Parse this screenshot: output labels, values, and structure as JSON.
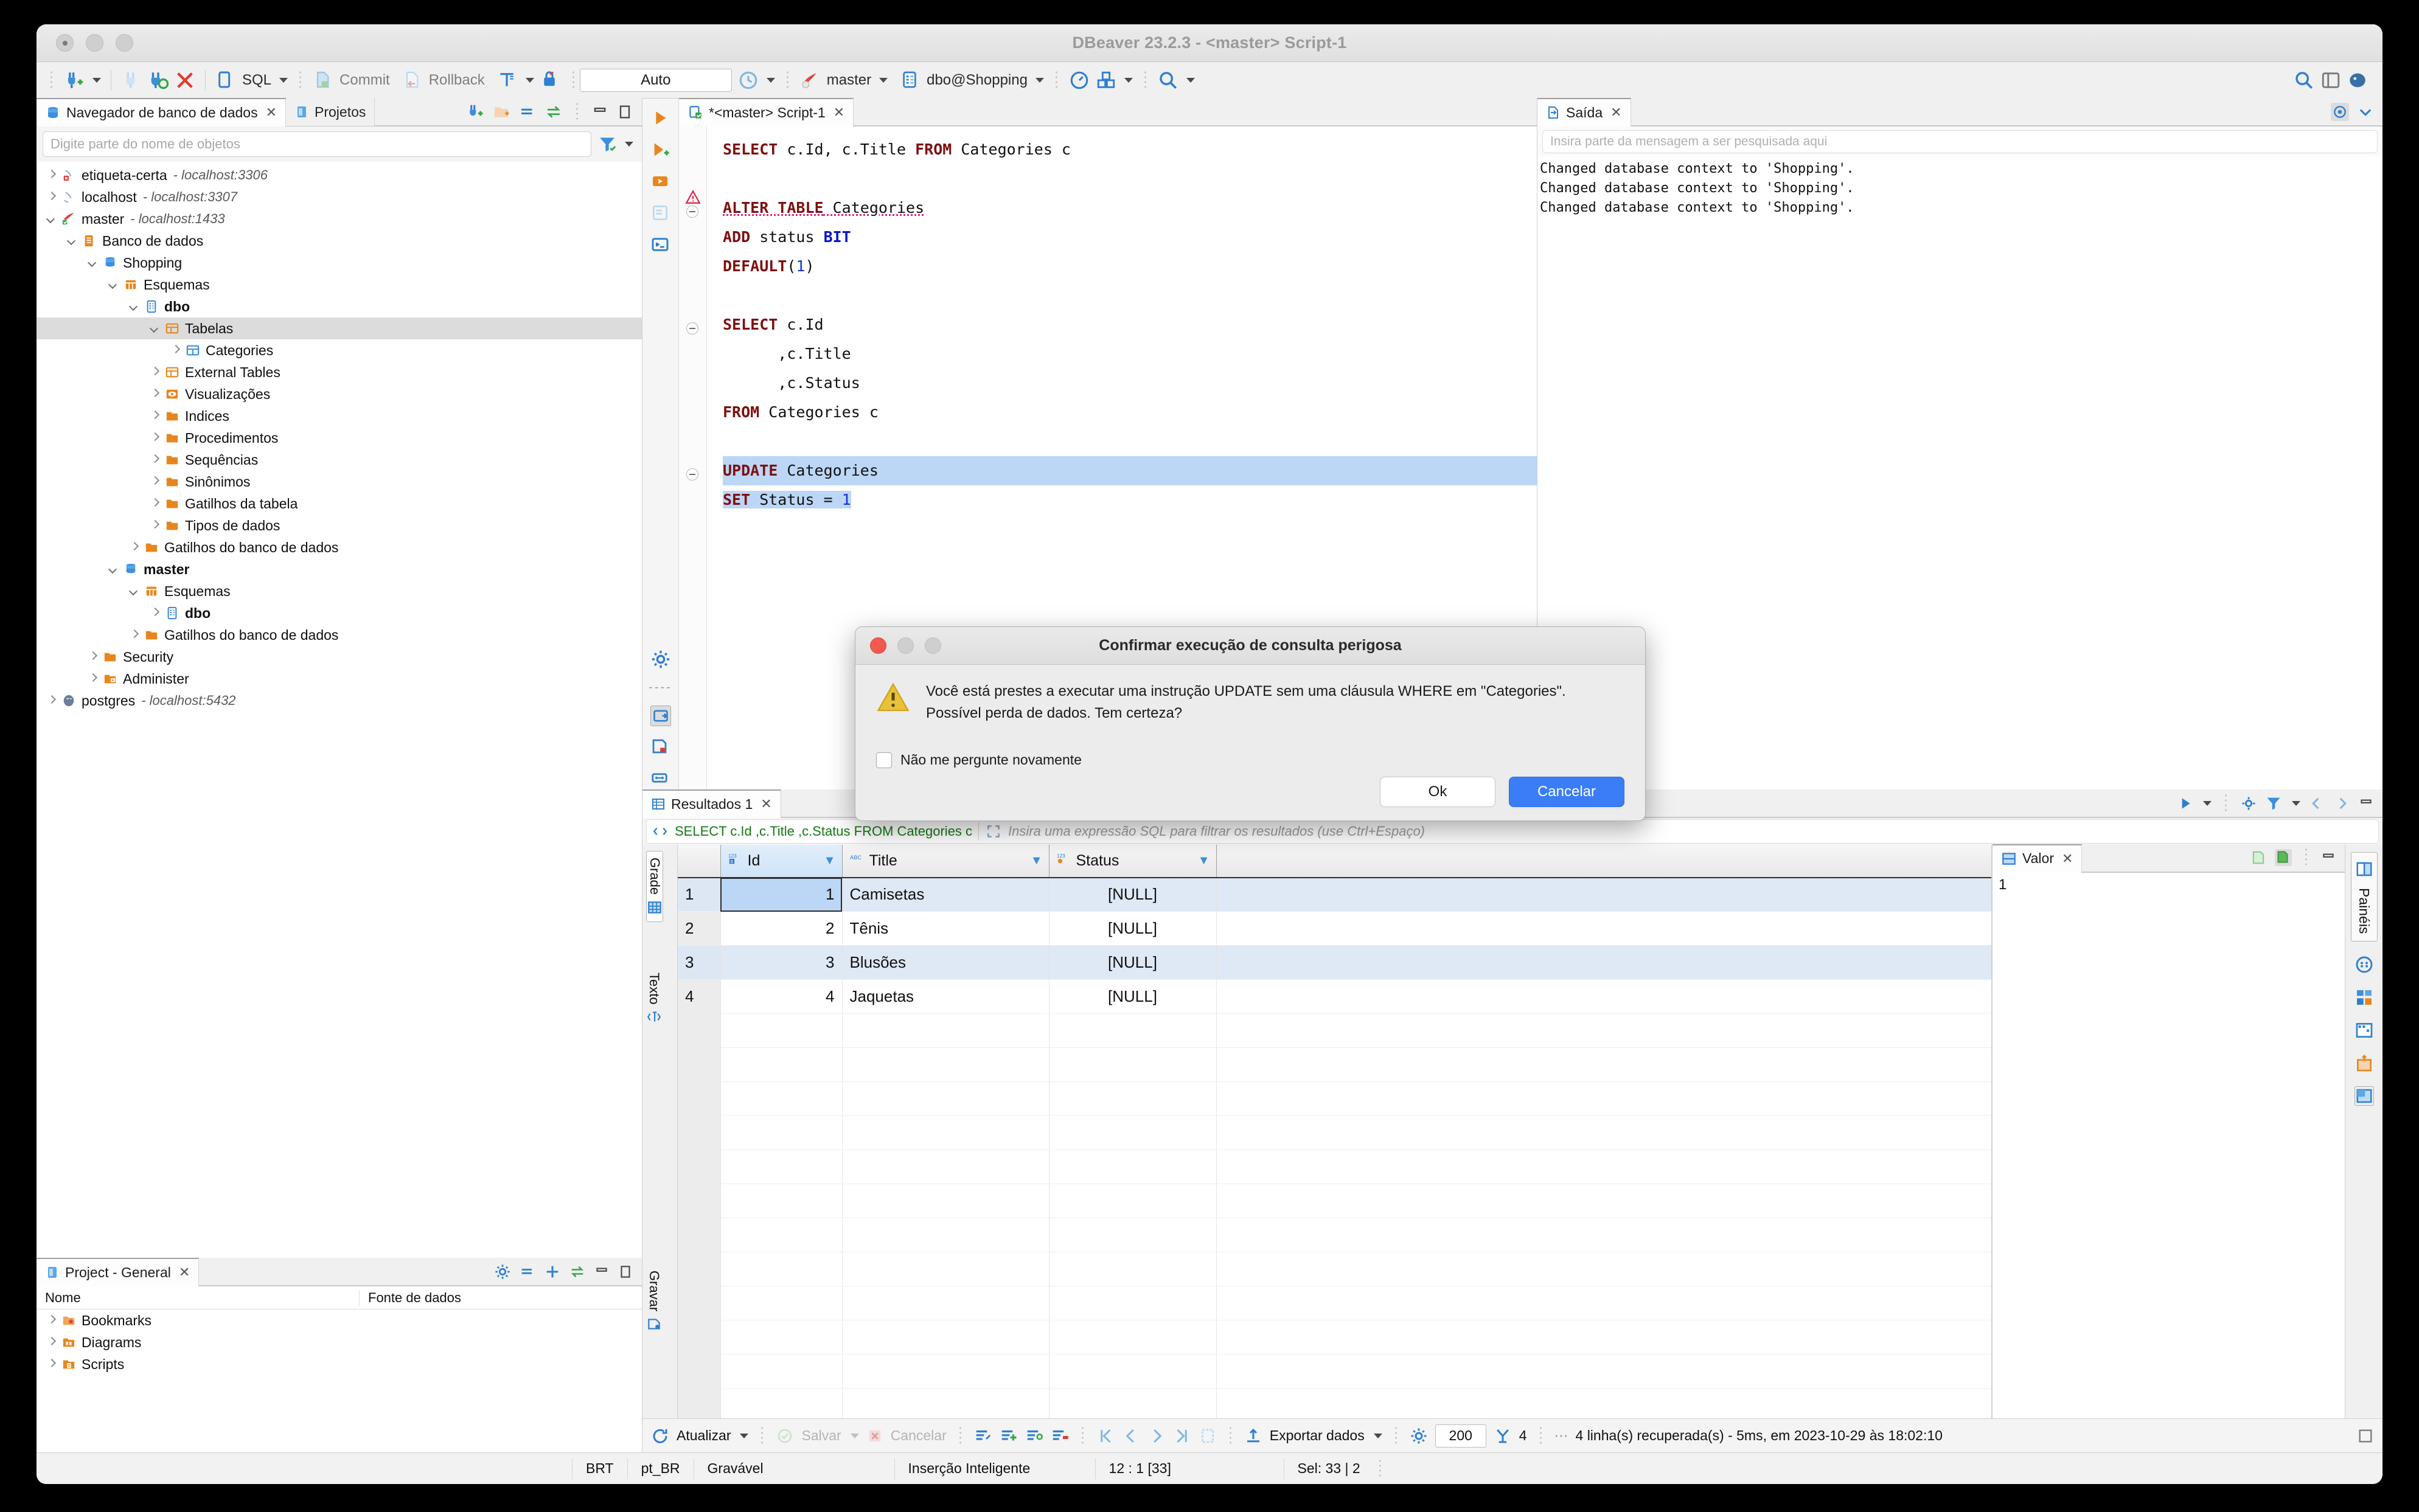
{
  "window": {
    "title": "DBeaver 23.2.3 - <master> Script-1"
  },
  "toolbar": {
    "sql_label": "SQL",
    "commit_label": "Commit",
    "rollback_label": "Rollback",
    "auto_label": "Auto",
    "connection_label": "master",
    "schema_label": "dbo@Shopping"
  },
  "navigator": {
    "tab_label": "Navegador de banco de dados",
    "projects_tab_label": "Projetos",
    "search_placeholder": "Digite parte do nome de objetos",
    "tree": [
      {
        "label": "etiqueta-certa",
        "host": "- localhost:3306",
        "depth": 0,
        "state": "collapsed",
        "icon": "connection-broken-icon"
      },
      {
        "label": "localhost",
        "host": "- localhost:3307",
        "depth": 0,
        "state": "collapsed",
        "icon": "connection-icon"
      },
      {
        "label": "master",
        "host": "- localhost:1433",
        "depth": 0,
        "state": "expanded",
        "icon": "mssql-icon"
      },
      {
        "label": "Banco de dados",
        "host": "",
        "depth": 1,
        "state": "expanded",
        "icon": "database-folder-icon"
      },
      {
        "label": "Shopping",
        "host": "",
        "depth": 2,
        "state": "expanded",
        "icon": "database-icon"
      },
      {
        "label": "Esquemas",
        "host": "",
        "depth": 3,
        "state": "expanded",
        "icon": "schemas-icon"
      },
      {
        "label": "dbo",
        "host": "",
        "depth": 4,
        "state": "expanded",
        "icon": "schema-icon",
        "bold": true
      },
      {
        "label": "Tabelas",
        "host": "",
        "depth": 5,
        "state": "expanded",
        "icon": "tables-icon",
        "selected": true
      },
      {
        "label": "Categories",
        "host": "",
        "depth": 6,
        "state": "collapsed",
        "icon": "table-icon"
      },
      {
        "label": "External Tables",
        "host": "",
        "depth": 5,
        "state": "collapsed",
        "icon": "tables-icon"
      },
      {
        "label": "Visualizações",
        "host": "",
        "depth": 5,
        "state": "collapsed",
        "icon": "views-icon"
      },
      {
        "label": "Indices",
        "host": "",
        "depth": 5,
        "state": "collapsed",
        "icon": "folder-icon"
      },
      {
        "label": "Procedimentos",
        "host": "",
        "depth": 5,
        "state": "collapsed",
        "icon": "folder-icon"
      },
      {
        "label": "Sequências",
        "host": "",
        "depth": 5,
        "state": "collapsed",
        "icon": "folder-icon"
      },
      {
        "label": "Sinônimos",
        "host": "",
        "depth": 5,
        "state": "collapsed",
        "icon": "folder-icon"
      },
      {
        "label": "Gatilhos da tabela",
        "host": "",
        "depth": 5,
        "state": "collapsed",
        "icon": "folder-icon"
      },
      {
        "label": "Tipos de dados",
        "host": "",
        "depth": 5,
        "state": "collapsed",
        "icon": "folder-icon"
      },
      {
        "label": "Gatilhos do banco de dados",
        "host": "",
        "depth": 4,
        "state": "collapsed",
        "icon": "folder-icon"
      },
      {
        "label": "master",
        "host": "",
        "depth": 3,
        "state": "expanded",
        "icon": "database-icon",
        "bold": true
      },
      {
        "label": "Esquemas",
        "host": "",
        "depth": 4,
        "state": "expanded",
        "icon": "schemas-icon"
      },
      {
        "label": "dbo",
        "host": "",
        "depth": 5,
        "state": "collapsed",
        "icon": "schema-icon",
        "bold": true
      },
      {
        "label": "Gatilhos do banco de dados",
        "host": "",
        "depth": 4,
        "state": "collapsed",
        "icon": "folder-icon"
      },
      {
        "label": "Security",
        "host": "",
        "depth": 2,
        "state": "collapsed",
        "icon": "folder-icon"
      },
      {
        "label": "Administer",
        "host": "",
        "depth": 2,
        "state": "collapsed",
        "icon": "admin-folder-icon"
      },
      {
        "label": "postgres",
        "host": "- localhost:5432",
        "depth": 0,
        "state": "collapsed",
        "icon": "postgres-icon"
      }
    ]
  },
  "project_panel": {
    "tab_label": "Project - General",
    "col_name": "Nome",
    "col_datasource": "Fonte de dados",
    "rows": [
      {
        "name": "Bookmarks",
        "datasource": "",
        "icon": "bookmarks-folder-icon"
      },
      {
        "name": "Diagrams",
        "datasource": "",
        "icon": "diagrams-folder-icon"
      },
      {
        "name": "Scripts",
        "datasource": "",
        "icon": "scripts-folder-icon"
      }
    ]
  },
  "editor": {
    "tab_label": "*<master> Script-1",
    "lines": [
      [
        {
          "t": "SELECT",
          "c": "kw"
        },
        {
          "t": " c.Id, c.Title "
        },
        {
          "t": "FROM",
          "c": "kw"
        },
        {
          "t": " Categories c"
        }
      ],
      [
        {
          "t": ""
        }
      ],
      [
        {
          "t": "ALTER TABLE",
          "c": "kw err"
        },
        {
          "t": " Categories",
          "c": "err"
        }
      ],
      [
        {
          "t": "ADD",
          "c": "kw"
        },
        {
          "t": " status "
        },
        {
          "t": "BIT",
          "c": "ty"
        }
      ],
      [
        {
          "t": "DEFAULT",
          "c": "kw"
        },
        {
          "t": "("
        },
        {
          "t": "1",
          "c": "num"
        },
        {
          "t": ")"
        }
      ],
      [
        {
          "t": ""
        }
      ],
      [
        {
          "t": "SELECT",
          "c": "kw"
        },
        {
          "t": " c.Id"
        }
      ],
      [
        {
          "t": "      ,c.Title"
        }
      ],
      [
        {
          "t": "      ,c.Status"
        }
      ],
      [
        {
          "t": "FROM",
          "c": "kw"
        },
        {
          "t": " Categories c"
        }
      ],
      [
        {
          "t": ""
        }
      ],
      [
        {
          "t": "UPDATE",
          "c": "kw"
        },
        {
          "t": " Categories"
        }
      ],
      [
        {
          "t": "SET",
          "c": "kw"
        },
        {
          "t": " Status = "
        },
        {
          "t": "1",
          "c": "num"
        }
      ]
    ]
  },
  "output": {
    "tab_label": "Saída",
    "search_placeholder": "Insira parte da mensagem a ser pesquisada aqui",
    "log_lines": [
      "Changed database context to 'Shopping'.",
      "Changed database context to 'Shopping'.",
      "Changed database context to 'Shopping'."
    ]
  },
  "results": {
    "tab_label": "Resultados 1",
    "filter_query": "SELECT c.Id ,c.Title ,c.Status FROM Categories c",
    "filter_placeholder": "Insira uma expressão SQL para filtrar os resultados (use Ctrl+Espaço)",
    "side_tabs": [
      {
        "label": "Grade",
        "icon": "grid-icon",
        "selected": true
      },
      {
        "label": "Texto",
        "icon": "text-icon",
        "selected": false
      },
      {
        "label": "Gravar",
        "icon": "record-icon",
        "selected": false
      }
    ],
    "columns": [
      {
        "label": "Id",
        "type_icon": "number-key-icon"
      },
      {
        "label": "Title",
        "type_icon": "abc-icon"
      },
      {
        "label": "Status",
        "type_icon": "number-icon"
      }
    ],
    "null_text": "[NULL]",
    "rows": [
      {
        "n": "1",
        "Id": "1",
        "Title": "Camisetas",
        "Status": "[NULL]"
      },
      {
        "n": "2",
        "Id": "2",
        "Title": "Tênis",
        "Status": "[NULL]"
      },
      {
        "n": "3",
        "Id": "3",
        "Title": "Blusões",
        "Status": "[NULL]"
      },
      {
        "n": "4",
        "Id": "4",
        "Title": "Jaquetas",
        "Status": "[NULL]"
      }
    ],
    "empty_row_count": 13,
    "toolbar": {
      "refresh_label": "Atualizar",
      "save_label": "Salvar",
      "cancel_label": "Cancelar",
      "export_label": "Exportar dados",
      "fetch_size": "200",
      "row_count": "4",
      "fetch_info": "4 linha(s) recuperada(s) - 5ms, em 2023-10-29 às 18:02:10"
    }
  },
  "value_panel": {
    "tab_label": "Valor",
    "value": "1"
  },
  "panels_strip": {
    "label": "Painéis"
  },
  "status_bar": {
    "timezone": "BRT",
    "locale": "pt_BR",
    "writable": "Gravável",
    "insert_mode": "Inserção Inteligente",
    "position": "12 : 1 [33]",
    "selection": "Sel: 33 | 2"
  },
  "dialog": {
    "title": "Confirmar execução de consulta perigosa",
    "message_line1": "Você está prestes a executar uma instrução UPDATE sem uma cláusula WHERE em \"Categories\".",
    "message_line2": "Possível perda de dados. Tem certeza?",
    "checkbox_label": "Não me pergunte novamente",
    "ok_label": "Ok",
    "cancel_label": "Cancelar"
  },
  "colors": {
    "accent_blue": "#3b7df6",
    "keyword_red": "#7d1010",
    "type_blue": "#0a16c4",
    "selection_blue": "#bcd6f5",
    "output_green": "#157a15",
    "folder_orange": "#e8861e"
  }
}
